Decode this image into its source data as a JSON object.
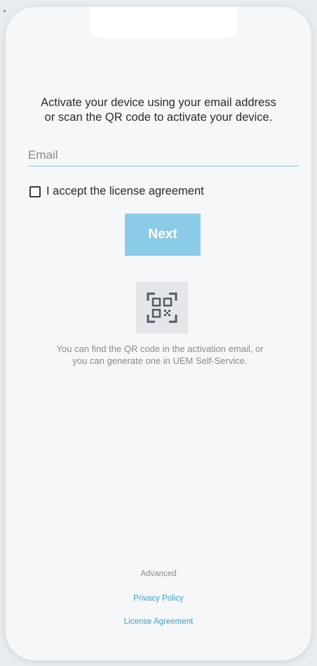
{
  "activation": {
    "intro_text": "Activate your device using your email address\nor scan the QR code to activate your device.",
    "email_placeholder": "Email",
    "accept_label": "I accept the license agreement",
    "next_label": "Next",
    "qr_icon": "qr-code-icon",
    "qr_help_text": "You can find the QR code in the activation email, or\nyou can generate one in UEM Self-Service."
  },
  "footer": {
    "advanced_label": "Advanced",
    "privacy_link": "Privacy Policy",
    "license_link": "License Agreement"
  },
  "colors": {
    "accent": "#8ccbe7",
    "link": "#3fa0c8",
    "input_underline": "#8fc7de"
  }
}
